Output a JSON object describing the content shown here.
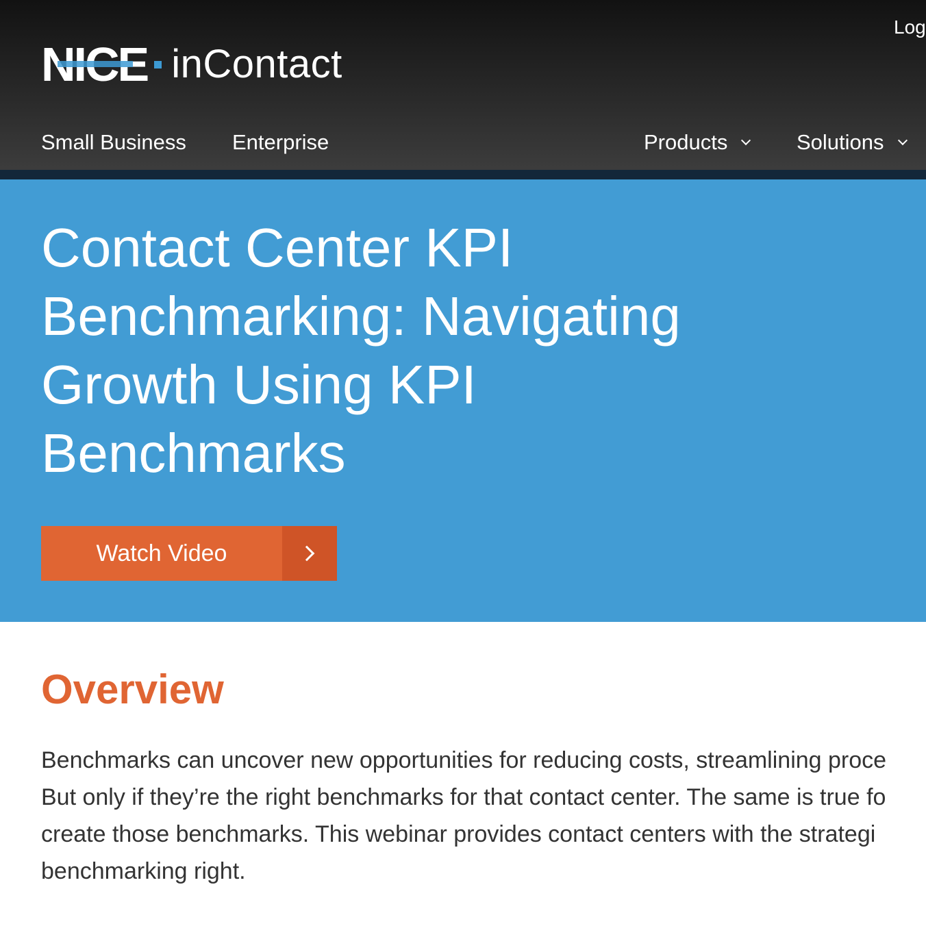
{
  "header": {
    "login_label": "Log",
    "logo": {
      "nice": "NICE",
      "incontact": "inContact"
    },
    "nav_left": [
      {
        "label": "Small Business"
      },
      {
        "label": "Enterprise"
      }
    ],
    "nav_right": [
      {
        "label": "Products",
        "icon": "chevron-down-icon"
      },
      {
        "label": "Solutions",
        "icon": "chevron-down-icon"
      }
    ],
    "bar_color": "#13273a"
  },
  "hero": {
    "background_color": "#429cd4",
    "title": "Contact Center KPI Benchmarking: Navigating Growth Using KPI Benchmarks",
    "cta": {
      "label": "Watch Video",
      "icon": "chevron-right-icon",
      "color": "#e06533"
    }
  },
  "overview": {
    "heading": "Overview",
    "heading_color": "#e06533",
    "lines": [
      "Benchmarks can uncover new opportunities for reducing costs, streamlining proce",
      "But only if they’re the right benchmarks for that contact center. The same is true fo",
      "create those benchmarks. This webinar provides contact centers with the strategi",
      "benchmarking right."
    ]
  }
}
